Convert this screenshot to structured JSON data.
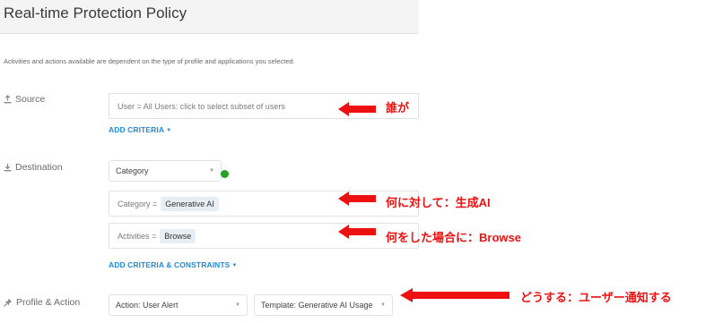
{
  "page": {
    "title": "Real-time Protection Policy",
    "description": "Activities and actions available are dependent on the type of profile and applications you selected."
  },
  "source": {
    "label": "Source",
    "user_field": "User = All Users: click to select subset of users",
    "add_criteria": "ADD CRITERIA"
  },
  "destination": {
    "label": "Destination",
    "select_value": "Category",
    "category_prefix": "Category =",
    "category_value": "Generative AI",
    "activities_prefix": "Activities =",
    "activities_value": "Browse",
    "add_criteria": "ADD CRITERIA & CONSTRAINTS"
  },
  "profile_action": {
    "label": "Profile & Action",
    "action_value": "Action: User Alert",
    "template_value": "Template: Generative AI Usage"
  },
  "annotations": {
    "who": "誰が",
    "against_what": "何に対して：生成AI",
    "when_did": "何をした場合に：Browse",
    "what_to_do": "どうする：ユーザー通知する"
  },
  "colors": {
    "accent_link": "#1e8bd6",
    "annotation_red": "#ee1111",
    "status_dot": "#27a227"
  },
  "icons": {
    "source": "upload-icon",
    "destination": "download-icon",
    "profile_action": "pin-icon"
  }
}
